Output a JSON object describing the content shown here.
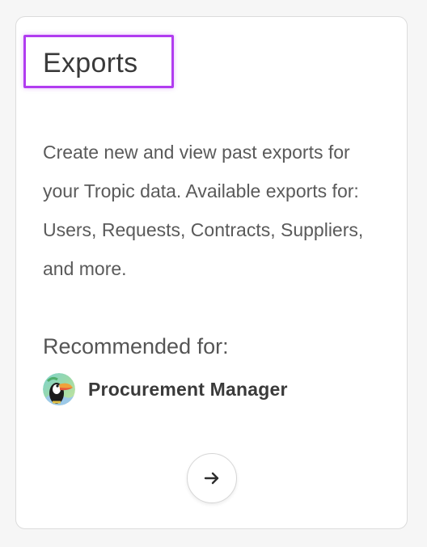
{
  "card": {
    "title": "Exports",
    "description": "Create new and view past exports for your Tropic data. Available exports for: Users, Requests, Contracts, Suppliers, and more.",
    "recommended_label": "Recommended for:",
    "persona": {
      "name": "Procurement Manager",
      "avatar_icon": "toucan-avatar-icon"
    },
    "action": {
      "icon": "arrow-right-icon"
    }
  },
  "colors": {
    "highlight": "#b13cf0",
    "card_border": "#dcdcdc",
    "background": "#f6f6f6"
  }
}
